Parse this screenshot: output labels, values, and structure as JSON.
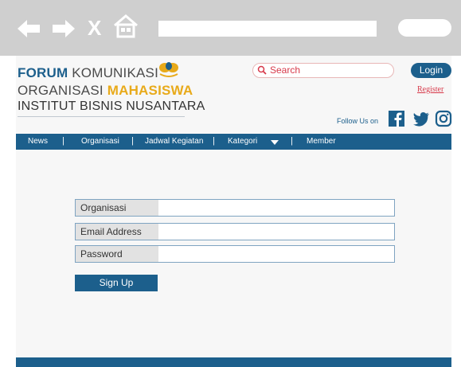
{
  "browser": {
    "back_icon": "back-arrow-icon",
    "forward_icon": "forward-arrow-icon",
    "close_label": "X",
    "home_icon": "home-icon"
  },
  "header": {
    "logo": {
      "line1_bold": "FORUM",
      "line1_rest": " KOMUNIKASI",
      "line2_rest": "ORGANISASI ",
      "line2_bold": "MAHASISWA",
      "line3": "INSTITUT BISNIS NUSANTARA"
    },
    "search": {
      "placeholder": "Search",
      "icon": "search-icon"
    },
    "login_label": "Login",
    "register_label": "Register",
    "follow_label": "Follow Us on",
    "social": [
      "facebook-icon",
      "twitter-icon",
      "instagram-icon"
    ]
  },
  "nav": {
    "items": [
      "News",
      "Organisasi",
      "Jadwal Kegiatan",
      "Kategori",
      "Member"
    ],
    "separator": "|"
  },
  "form": {
    "fields": [
      {
        "label": "Organisasi",
        "value": ""
      },
      {
        "label": "Email Address",
        "value": ""
      },
      {
        "label": "Password",
        "value": ""
      }
    ],
    "submit_label": "Sign Up"
  },
  "colors": {
    "primary": "#1c5f8c",
    "accent": "#e8aa1a",
    "link": "#d7394a",
    "chrome": "#cfcfcf"
  }
}
